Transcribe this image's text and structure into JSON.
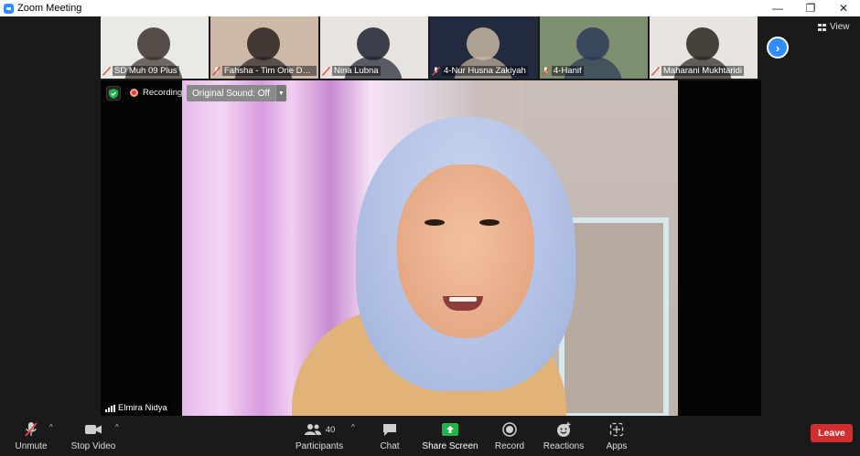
{
  "window": {
    "title": "Zoom Meeting"
  },
  "gallery": {
    "tiles": [
      {
        "name": "SD Muh 09 Plus",
        "bg": "#e9e9e6",
        "fg": "#3b2f2a"
      },
      {
        "name": "Fahsha - Tim One Day ...",
        "bg": "#cdb9a8",
        "fg": "#2a2220"
      },
      {
        "name": "Nina Lubna",
        "bg": "#e6e3e0",
        "fg": "#1d2230"
      },
      {
        "name": "4-Nur Husna Zakiyah",
        "bg": "#222a40",
        "fg": "#c7b6a0"
      },
      {
        "name": "4-Hanif",
        "bg": "#7e8f6f",
        "fg": "#2b3b58"
      },
      {
        "name": "Maharani Mukhtaridi",
        "bg": "#e7e3df",
        "fg": "#2a2420"
      }
    ],
    "next_glyph": "›",
    "view_label": "View"
  },
  "main": {
    "recording_label": "Recording",
    "original_sound_label": "Original Sound: Off",
    "speaker_name": "Elmira Nidya"
  },
  "toolbar": {
    "unmute": "Unmute",
    "stop_video": "Stop Video",
    "participants": "Participants",
    "participants_count": "40",
    "chat": "Chat",
    "share_screen": "Share Screen",
    "record": "Record",
    "reactions": "Reactions",
    "apps": "Apps",
    "leave": "Leave"
  },
  "colors": {
    "accent": "#2d8cff",
    "share_green": "#21b34a",
    "leave_red": "#d12e2e",
    "mute_red": "#e04a3a"
  }
}
